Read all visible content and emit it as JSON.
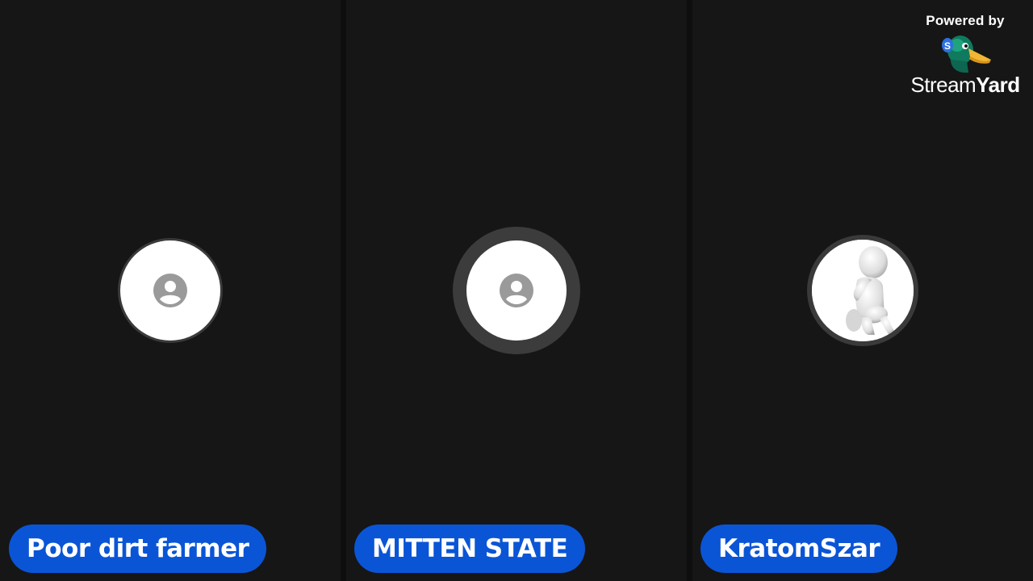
{
  "branding": {
    "powered_by": "Powered by",
    "name_light": "Stream",
    "name_bold": "Yard",
    "logo_icon": "duck-mascot-icon"
  },
  "participants": [
    {
      "name": "Poor dirt farmer",
      "avatar": "default-user-icon"
    },
    {
      "name": "MITTEN STATE",
      "avatar": "default-user-icon",
      "speaking": true
    },
    {
      "name": "KratomSzar",
      "avatar": "thinking-figure-image"
    }
  ],
  "colors": {
    "background": "#0e0e0e",
    "tile": "#161616",
    "name_pill": "#0a55d6",
    "avatar_bg": "#ffffff",
    "avatar_ring": "#3a3a3a",
    "user_icon": "#9a9a9a"
  }
}
